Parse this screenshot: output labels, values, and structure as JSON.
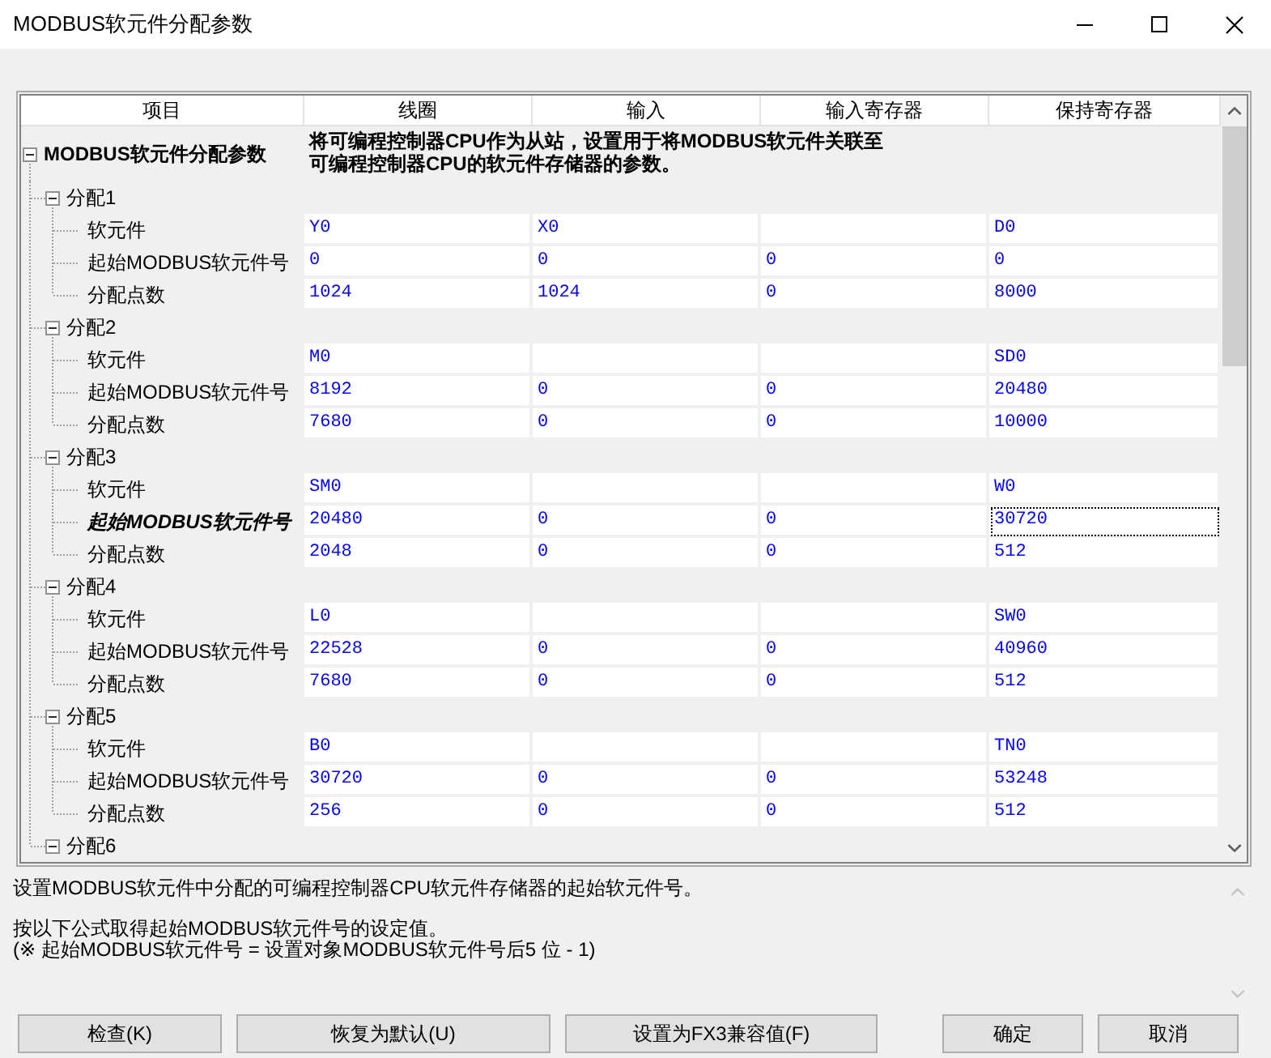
{
  "window": {
    "title": "MODBUS软元件分配参数"
  },
  "table": {
    "columns": [
      "项目",
      "线圈",
      "输入",
      "输入寄存器",
      "保持寄存器"
    ],
    "root": {
      "label": "MODBUS软元件分配参数",
      "expanded": true,
      "description_lines": [
        "将可编程控制器CPU作为从站，设置用于将MODBUS软元件关联至",
        "可编程控制器CPU的软元件存储器的参数。"
      ]
    },
    "groups": [
      {
        "label": "分配1",
        "expanded": true,
        "rows": [
          {
            "label": "软元件",
            "selected": false,
            "cells": [
              {
                "value": "Y0",
                "focused": false
              },
              {
                "value": "X0",
                "focused": false
              },
              {
                "focused": false
              },
              {
                "value": "D0",
                "focused": false
              }
            ]
          },
          {
            "label": "起始MODBUS软元件号",
            "selected": false,
            "cells": [
              {
                "value": "0",
                "focused": false
              },
              {
                "value": "0",
                "focused": false
              },
              {
                "value": "0",
                "focused": false
              },
              {
                "value": "0",
                "focused": false
              }
            ]
          },
          {
            "label": "分配点数",
            "selected": false,
            "cells": [
              {
                "value": "1024",
                "focused": false
              },
              {
                "value": "1024",
                "focused": false
              },
              {
                "value": "0",
                "focused": false
              },
              {
                "value": "8000",
                "focused": false
              }
            ]
          }
        ]
      },
      {
        "label": "分配2",
        "expanded": true,
        "rows": [
          {
            "label": "软元件",
            "selected": false,
            "cells": [
              {
                "value": "M0",
                "focused": false
              },
              {
                "focused": false
              },
              {
                "focused": false
              },
              {
                "value": "SD0",
                "focused": false
              }
            ]
          },
          {
            "label": "起始MODBUS软元件号",
            "selected": false,
            "cells": [
              {
                "value": "8192",
                "focused": false
              },
              {
                "value": "0",
                "focused": false
              },
              {
                "value": "0",
                "focused": false
              },
              {
                "value": "20480",
                "focused": false
              }
            ]
          },
          {
            "label": "分配点数",
            "selected": false,
            "cells": [
              {
                "value": "7680",
                "focused": false
              },
              {
                "value": "0",
                "focused": false
              },
              {
                "value": "0",
                "focused": false
              },
              {
                "value": "10000",
                "focused": false
              }
            ]
          }
        ]
      },
      {
        "label": "分配3",
        "expanded": true,
        "rows": [
          {
            "label": "软元件",
            "selected": false,
            "cells": [
              {
                "value": "SM0",
                "focused": false
              },
              {
                "focused": false
              },
              {
                "focused": false
              },
              {
                "value": "W0",
                "focused": false
              }
            ]
          },
          {
            "label": "起始MODBUS软元件号",
            "selected": true,
            "cells": [
              {
                "value": "20480",
                "focused": false
              },
              {
                "value": "0",
                "focused": false
              },
              {
                "value": "0",
                "focused": false
              },
              {
                "value": "30720",
                "focused": true
              }
            ]
          },
          {
            "label": "分配点数",
            "selected": false,
            "cells": [
              {
                "value": "2048",
                "focused": false
              },
              {
                "value": "0",
                "focused": false
              },
              {
                "value": "0",
                "focused": false
              },
              {
                "value": "512",
                "focused": false
              }
            ]
          }
        ]
      },
      {
        "label": "分配4",
        "expanded": true,
        "rows": [
          {
            "label": "软元件",
            "selected": false,
            "cells": [
              {
                "value": "L0",
                "focused": false
              },
              {
                "focused": false
              },
              {
                "focused": false
              },
              {
                "value": "SW0",
                "focused": false
              }
            ]
          },
          {
            "label": "起始MODBUS软元件号",
            "selected": false,
            "cells": [
              {
                "value": "22528",
                "focused": false
              },
              {
                "value": "0",
                "focused": false
              },
              {
                "value": "0",
                "focused": false
              },
              {
                "value": "40960",
                "focused": false
              }
            ]
          },
          {
            "label": "分配点数",
            "selected": false,
            "cells": [
              {
                "value": "7680",
                "focused": false
              },
              {
                "value": "0",
                "focused": false
              },
              {
                "value": "0",
                "focused": false
              },
              {
                "value": "512",
                "focused": false
              }
            ]
          }
        ]
      },
      {
        "label": "分配5",
        "expanded": true,
        "rows": [
          {
            "label": "软元件",
            "selected": false,
            "cells": [
              {
                "value": "B0",
                "focused": false
              },
              {
                "focused": false
              },
              {
                "focused": false
              },
              {
                "value": "TN0",
                "focused": false
              }
            ]
          },
          {
            "label": "起始MODBUS软元件号",
            "selected": false,
            "cells": [
              {
                "value": "30720",
                "focused": false
              },
              {
                "value": "0",
                "focused": false
              },
              {
                "value": "0",
                "focused": false
              },
              {
                "value": "53248",
                "focused": false
              }
            ]
          },
          {
            "label": "分配点数",
            "selected": false,
            "cells": [
              {
                "value": "256",
                "focused": false
              },
              {
                "value": "0",
                "focused": false
              },
              {
                "value": "0",
                "focused": false
              },
              {
                "value": "512",
                "focused": false
              }
            ]
          }
        ]
      },
      {
        "label": "分配6",
        "expanded": true
      }
    ]
  },
  "help": {
    "paragraphs": [
      [
        "设置MODBUS软元件中分配的可编程控制器CPU软元件存储器的起始软元件号。"
      ],
      [
        "按以下公式取得起始MODBUS软元件号的设定值。",
        "(※ 起始MODBUS软元件号 = 设置对象MODBUS软元件号后5 位 - 1)"
      ]
    ]
  },
  "buttons": {
    "left": [
      "检查(K)",
      "恢复为默认(U)",
      "设置为FX3兼容值(F)"
    ],
    "right": [
      "确定",
      "取消"
    ]
  }
}
